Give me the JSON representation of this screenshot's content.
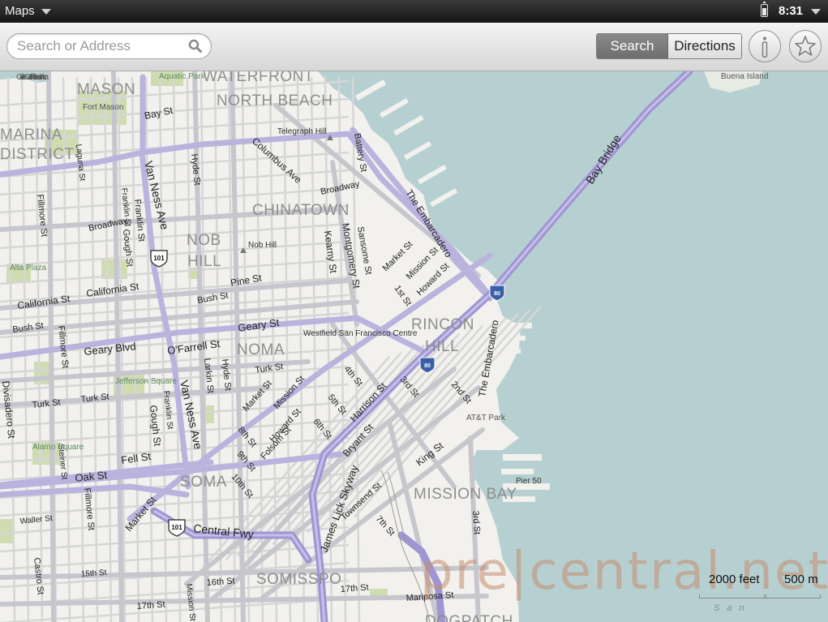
{
  "statusbar": {
    "app_name": "Maps",
    "time": "8:31"
  },
  "toolbar": {
    "search_placeholder": "Search or Address",
    "search_tab": "Search",
    "directions_tab": "Directions"
  },
  "map": {
    "districts": [
      "MASON",
      "WATERFRONT",
      "NORTH BEACH",
      "MARINA",
      "DISTRICT",
      "CHINATOWN",
      "NOB",
      "HILL",
      "RINCON",
      "HILL",
      "NOMA",
      "SOMA",
      "MISSION BAY",
      "SOMISSPO",
      "DOGPATCH"
    ],
    "streets": [
      "Bay St",
      "Columbus Ave",
      "Battery St",
      "Broadway",
      "Van Ness Ave",
      "Hyde St",
      "Laguna St",
      "Fillmore St",
      "Franklin St",
      "Gough St",
      "Broadway",
      "Kearny St",
      "Montgomery St",
      "Sansome St",
      "Market St",
      "Mission St",
      "Howard St",
      "1st St",
      "The Embarcadero",
      "Bay Bridge",
      "Pine St",
      "California St",
      "California St",
      "Bush St",
      "Bush St",
      "Geary St",
      "Geary Blvd",
      "O'Farrell St",
      "Larkin St",
      "Hyde St",
      "Turk St",
      "Turk St",
      "Turk St",
      "Market St",
      "Mission St",
      "4th St",
      "5th St",
      "Howard St",
      "6th St",
      "8th St",
      "9th St",
      "Folsom St",
      "10th St",
      "Harrison St",
      "3rd St",
      "2nd St",
      "The Embarcadero",
      "Bryant St",
      "King St",
      "James Lick Skyway",
      "Townsend St",
      "7th St",
      "Divisadero St",
      "Fillmore St",
      "Steiner St",
      "Fell St",
      "Oak St",
      "Fillmore St",
      "Waller St",
      "Market St",
      "Central Fwy",
      "Castro St",
      "15th St",
      "16th St",
      "17th St",
      "17th St",
      "Mission St",
      "Mariposa St",
      "3rd St",
      "Van Ness Ave",
      "Gough St",
      "Franklin St",
      "Franklin St"
    ],
    "pois": [
      "Golden Gate Nat'l Recreation Area",
      "Aquatic Park",
      "Fort Mason",
      "Telegraph Hill",
      "Nob Hill",
      "Alta Plaza",
      "Westfield San Francisco Centre",
      "Jefferson Square",
      "Alamo Square",
      "AT&T Park",
      "Pier 50",
      "Buena Island"
    ],
    "highway_shields": [
      "101",
      "80",
      "80",
      "101"
    ]
  },
  "watermark": "pre|central.net",
  "scale": {
    "feet": "2000 feet",
    "meters": "500 m",
    "caption": "San"
  }
}
